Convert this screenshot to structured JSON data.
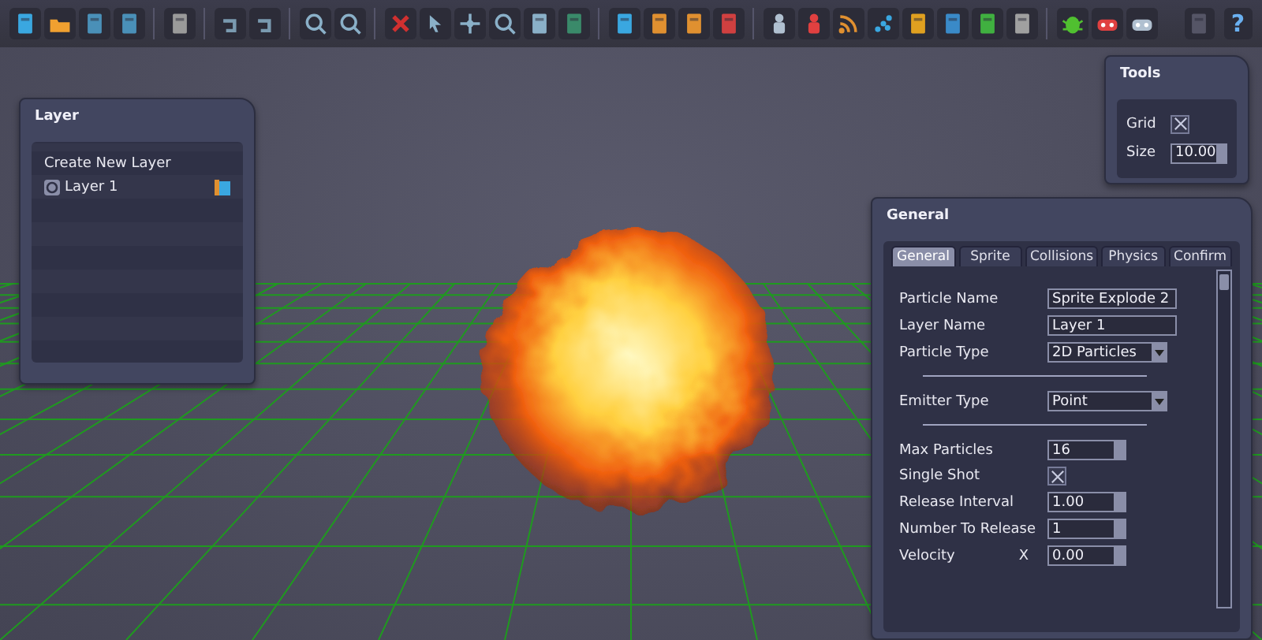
{
  "toolbar": {
    "help_glyph": "?"
  },
  "layer_panel": {
    "title": "Layer",
    "create_label": "Create New Layer",
    "layers": [
      {
        "name": "Layer 1"
      }
    ]
  },
  "tools_panel": {
    "title": "Tools",
    "fields": [
      {
        "kind": "checkbox",
        "label": "Grid",
        "checked": true
      },
      {
        "kind": "spin",
        "label": "Size",
        "value": "10.00"
      }
    ]
  },
  "general_panel": {
    "title": "General",
    "tabs": [
      {
        "label": "General",
        "selected": true
      },
      {
        "label": "Sprite",
        "selected": false
      },
      {
        "label": "Collisions",
        "selected": false
      },
      {
        "label": "Physics",
        "selected": false
      },
      {
        "label": "Confirm",
        "selected": false
      }
    ],
    "fields": [
      {
        "kind": "text",
        "label": "Particle Name",
        "value": "Sprite Explode 2"
      },
      {
        "kind": "text",
        "label": "Layer Name",
        "value": "Layer 1"
      },
      {
        "kind": "dropdown",
        "label": "Particle Type",
        "value": "2D Particles"
      },
      {
        "kind": "separator"
      },
      {
        "kind": "dropdown",
        "label": "Emitter Type",
        "value": "Point"
      },
      {
        "kind": "separator"
      },
      {
        "kind": "spin",
        "label": "Max Particles",
        "value": "16"
      },
      {
        "kind": "checkbox",
        "label": "Single Shot",
        "checked": true
      },
      {
        "kind": "spin",
        "label": "Release Interval",
        "value": "1.00"
      },
      {
        "kind": "spin",
        "label": "Number To Release",
        "value": "1"
      },
      {
        "kind": "vector",
        "label": "Velocity",
        "axis": "X",
        "value": "0.00"
      }
    ]
  }
}
